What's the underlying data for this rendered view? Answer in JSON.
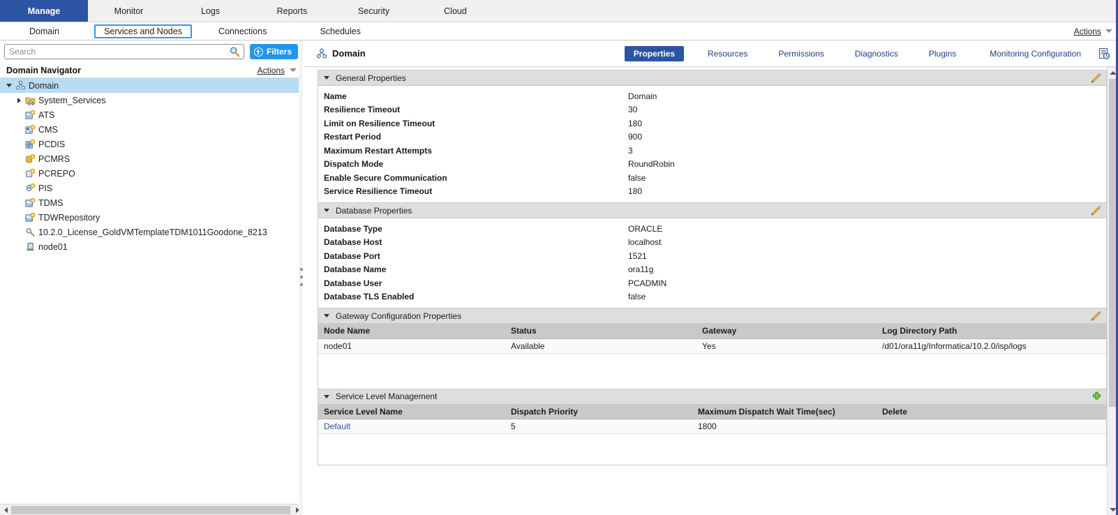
{
  "topnav": {
    "items": [
      {
        "label": "Manage",
        "active": true
      },
      {
        "label": "Monitor",
        "active": false
      },
      {
        "label": "Logs",
        "active": false
      },
      {
        "label": "Reports",
        "active": false
      },
      {
        "label": "Security",
        "active": false
      },
      {
        "label": "Cloud",
        "active": false
      }
    ]
  },
  "subnav": {
    "items": [
      {
        "label": "Domain",
        "selected": false
      },
      {
        "label": "Services and Nodes",
        "selected": true
      },
      {
        "label": "Connections",
        "selected": false
      },
      {
        "label": "Schedules",
        "selected": false
      }
    ],
    "actions_label": "Actions"
  },
  "sidebar": {
    "search": {
      "placeholder": "Search",
      "value": "",
      "icon": "search-icon"
    },
    "filters_label": "Filters",
    "navigator_title": "Domain Navigator",
    "navigator_actions_label": "Actions",
    "tree": [
      {
        "label": "Domain",
        "icon": "domain-icon",
        "indent": 0,
        "twisty": "down",
        "selected": true
      },
      {
        "label": "System_Services",
        "icon": "folder-services-icon",
        "indent": 1,
        "twisty": "right",
        "selected": false
      },
      {
        "label": "ATS",
        "icon": "service-ats-icon",
        "indent": 1,
        "twisty": "none",
        "selected": false
      },
      {
        "label": "CMS",
        "icon": "service-cms-icon",
        "indent": 1,
        "twisty": "none",
        "selected": false
      },
      {
        "label": "PCDIS",
        "icon": "service-pcdis-icon",
        "indent": 1,
        "twisty": "none",
        "selected": false
      },
      {
        "label": "PCMRS",
        "icon": "service-pcmrs-icon",
        "indent": 1,
        "twisty": "none",
        "selected": false
      },
      {
        "label": "PCREPO",
        "icon": "service-pcrepo-icon",
        "indent": 1,
        "twisty": "none",
        "selected": false
      },
      {
        "label": "PIS",
        "icon": "service-pis-icon",
        "indent": 1,
        "twisty": "none",
        "selected": false
      },
      {
        "label": "TDMS",
        "icon": "service-tdms-icon",
        "indent": 1,
        "twisty": "none",
        "selected": false
      },
      {
        "label": "TDWRepository",
        "icon": "service-tdw-icon",
        "indent": 1,
        "twisty": "none",
        "selected": false
      },
      {
        "label": "10.2.0_License_GoldVMTemplateTDM1011Goodone_8213",
        "icon": "license-key-icon",
        "indent": 1,
        "twisty": "none",
        "selected": false
      },
      {
        "label": "node01",
        "icon": "node-icon",
        "indent": 1,
        "twisty": "none",
        "selected": false
      }
    ]
  },
  "object_header": {
    "title": "Domain",
    "icon": "domain-icon",
    "history_icon": "log-history-icon",
    "tabs": [
      {
        "label": "Properties",
        "active": true
      },
      {
        "label": "Resources",
        "active": false
      },
      {
        "label": "Permissions",
        "active": false
      },
      {
        "label": "Diagnostics",
        "active": false
      },
      {
        "label": "Plugins",
        "active": false
      },
      {
        "label": "Monitoring Configuration",
        "active": false
      }
    ]
  },
  "sections": {
    "general": {
      "title": "General Properties",
      "edit_icon": "edit-pencil-icon",
      "rows": [
        {
          "label": "Name",
          "value": "Domain"
        },
        {
          "label": "Resilience Timeout",
          "value": "30"
        },
        {
          "label": "Limit on Resilience Timeout",
          "value": "180"
        },
        {
          "label": "Restart Period",
          "value": "900"
        },
        {
          "label": "Maximum Restart Attempts",
          "value": "3"
        },
        {
          "label": "Dispatch Mode",
          "value": "RoundRobin"
        },
        {
          "label": "Enable Secure Communication",
          "value": "false"
        },
        {
          "label": "Service Resilience Timeout",
          "value": "180"
        }
      ]
    },
    "database": {
      "title": "Database Properties",
      "edit_icon": "edit-pencil-icon",
      "rows": [
        {
          "label": "Database Type",
          "value": "ORACLE"
        },
        {
          "label": "Database Host",
          "value": "localhost"
        },
        {
          "label": "Database Port",
          "value": "1521"
        },
        {
          "label": "Database Name",
          "value": "ora11g"
        },
        {
          "label": "Database User",
          "value": "PCADMIN"
        },
        {
          "label": "Database TLS Enabled",
          "value": "false"
        }
      ]
    },
    "gateway": {
      "title": "Gateway Configuration Properties",
      "edit_icon": "edit-pencil-icon",
      "columns": [
        "Node Name",
        "Status",
        "Gateway",
        "Log Directory Path"
      ],
      "rows": [
        [
          "node01",
          "Available",
          "Yes",
          "/d01/ora11g/Informatica/10.2.0/isp/logs"
        ]
      ]
    },
    "service_level": {
      "title": "Service Level Management",
      "add_icon": "add-plus-icon",
      "columns": [
        "Service Level Name",
        "Dispatch Priority",
        "Maximum Dispatch Wait Time(sec)",
        "Delete"
      ],
      "rows": [
        [
          "Default",
          "5",
          "1800",
          ""
        ]
      ]
    }
  },
  "colors": {
    "primary_blue": "#2b55a2",
    "filters_blue": "#2196ee",
    "selection_blue": "#b8dcf4",
    "section_header_gray": "#dedede",
    "grid_header_gray": "#c9c9c9",
    "link_blue": "#22569e"
  }
}
